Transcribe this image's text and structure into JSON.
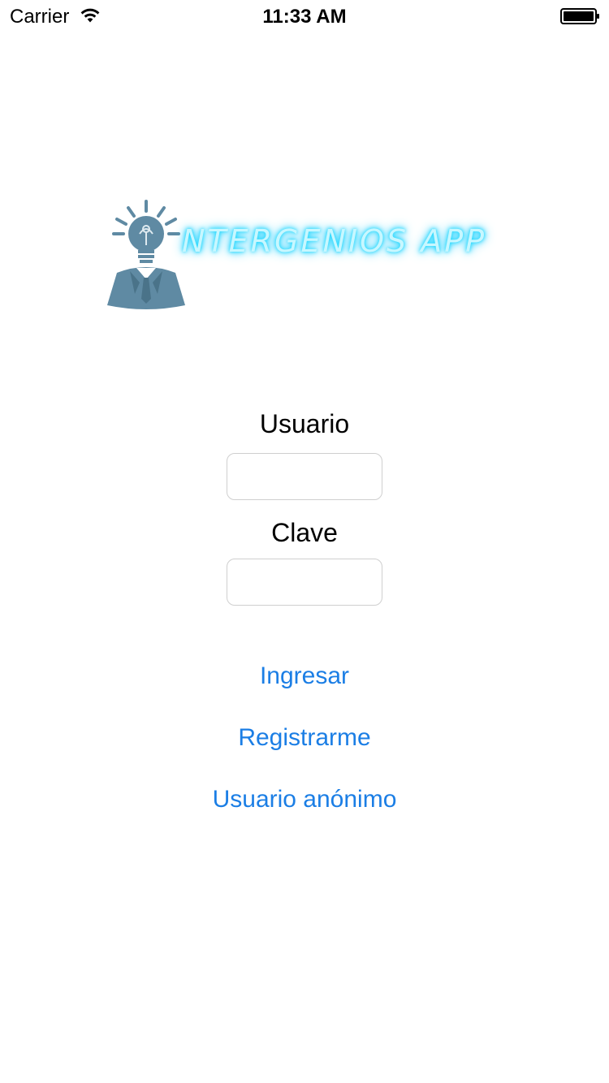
{
  "status_bar": {
    "carrier": "Carrier",
    "time": "11:33 AM",
    "wifi_icon": "wifi-icon",
    "battery_icon": "battery-icon"
  },
  "logo": {
    "text": "NTERGENIOS APP",
    "figure_icon": "lightbulb-head-person-icon",
    "figure_color": "#5f8aa3",
    "text_glow_color": "#18d7ff"
  },
  "form": {
    "username_label": "Usuario",
    "username_value": "",
    "password_label": "Clave",
    "password_value": ""
  },
  "actions": {
    "login": "Ingresar",
    "register": "Registrarme",
    "anonymous": "Usuario anónimo"
  },
  "colors": {
    "link": "#1b7ee5",
    "field_border": "#cfcfcf",
    "background": "#ffffff"
  }
}
